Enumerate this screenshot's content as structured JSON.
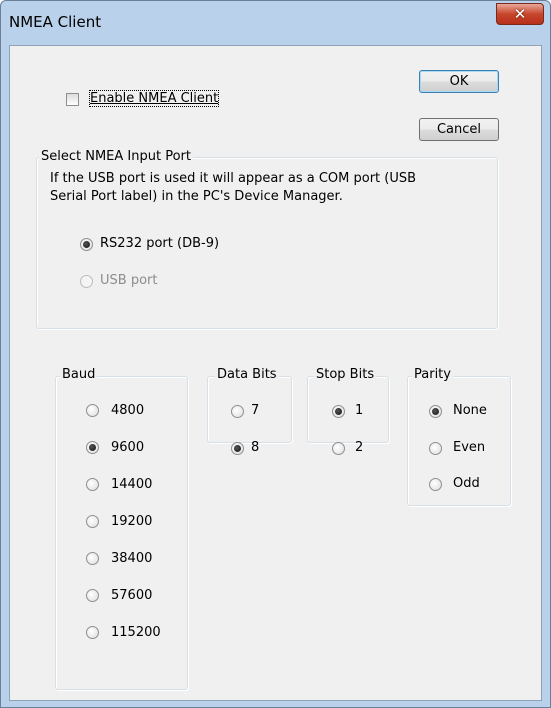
{
  "window": {
    "title": "NMEA Client",
    "close_glyph": "✕"
  },
  "buttons": {
    "ok_label": "OK",
    "cancel_label": "Cancel"
  },
  "enable": {
    "label": "Enable NMEA Client",
    "checked": false
  },
  "input_port": {
    "legend": "Select NMEA Input Port",
    "note_line1": "If the USB port is used it will appear as a  COM port (USB",
    "note_line2": "Serial Port label) in the PC's Device Manager.",
    "options": [
      {
        "label": "RS232 port (DB-9)",
        "checked": true,
        "enabled": true
      },
      {
        "label": "USB port",
        "checked": false,
        "enabled": false
      }
    ]
  },
  "baud": {
    "legend": "Baud",
    "options": [
      {
        "label": "4800",
        "checked": false
      },
      {
        "label": "9600",
        "checked": true
      },
      {
        "label": "14400",
        "checked": false
      },
      {
        "label": "19200",
        "checked": false
      },
      {
        "label": "38400",
        "checked": false
      },
      {
        "label": "57600",
        "checked": false
      },
      {
        "label": "115200",
        "checked": false
      }
    ]
  },
  "data_bits": {
    "legend": "Data Bits",
    "options": [
      {
        "label": "7",
        "checked": false
      },
      {
        "label": "8",
        "checked": true
      }
    ]
  },
  "stop_bits": {
    "legend": "Stop Bits",
    "options": [
      {
        "label": "1",
        "checked": true
      },
      {
        "label": "2",
        "checked": false
      }
    ]
  },
  "parity": {
    "legend": "Parity",
    "options": [
      {
        "label": "None",
        "checked": true
      },
      {
        "label": "Even",
        "checked": false
      },
      {
        "label": "Odd",
        "checked": false
      }
    ]
  }
}
